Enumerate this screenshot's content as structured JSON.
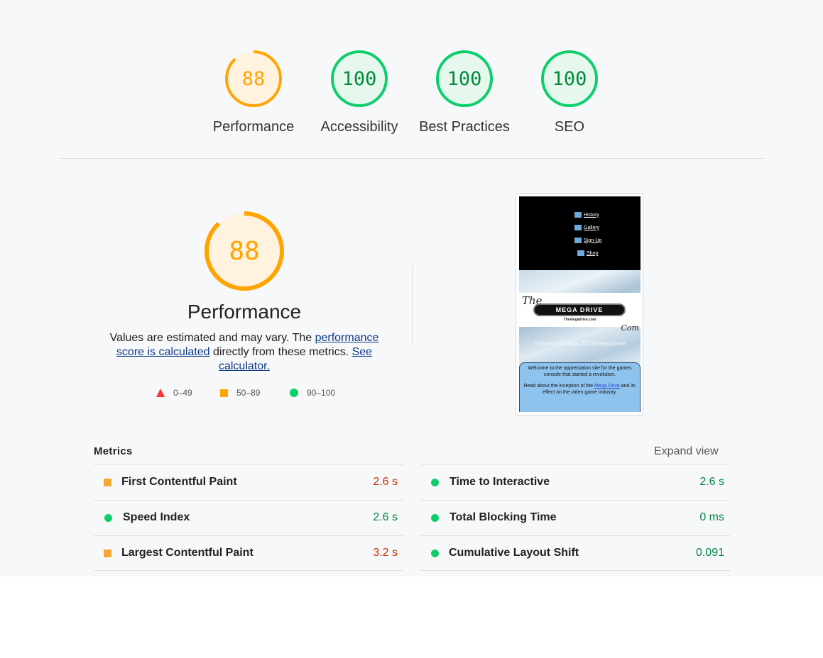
{
  "categories": [
    {
      "label": "Performance",
      "score": "88",
      "rating": "average"
    },
    {
      "label": "Accessibility",
      "score": "100",
      "rating": "pass"
    },
    {
      "label": "Best Practices",
      "score": "100",
      "rating": "pass"
    },
    {
      "label": "SEO",
      "score": "100",
      "rating": "pass"
    }
  ],
  "performance": {
    "score": "88",
    "title": "Performance",
    "desc_part1": "Values are estimated and may vary. The ",
    "desc_link1": "performance score is calculated",
    "desc_part2": " directly from these metrics. ",
    "desc_link2": "See calculator."
  },
  "legend": [
    {
      "range": "0–49",
      "shape": "triangle",
      "color": "#ff3333"
    },
    {
      "range": "50–89",
      "shape": "square",
      "color": "#ffa400"
    },
    {
      "range": "90–100",
      "shape": "circle",
      "color": "#0cce6b"
    }
  ],
  "thumbnail": {
    "nav": [
      "History",
      "Gallery",
      "Sign-Up",
      "Shop"
    ],
    "logo_the": "The",
    "logo_main": "MEGA DRIVE",
    "logo_site": "Themegadrive.com",
    "logo_com": "Com",
    "tagline": "Home of all things SEGA Megadrive",
    "welcome": "Welcome to the appreciation site for the games console that started a revolution.",
    "read_part1": "Read about the inception of the ",
    "read_link": "Mega Drive",
    "read_part2": " and its effect on the video game industry."
  },
  "metrics": {
    "title": "Metrics",
    "expand": "Expand view",
    "left": [
      {
        "name": "First Contentful Paint",
        "value": "2.6 s",
        "rating": "average"
      },
      {
        "name": "Speed Index",
        "value": "2.6 s",
        "rating": "pass"
      },
      {
        "name": "Largest Contentful Paint",
        "value": "3.2 s",
        "rating": "average"
      }
    ],
    "right": [
      {
        "name": "Time to Interactive",
        "value": "2.6 s",
        "rating": "pass"
      },
      {
        "name": "Total Blocking Time",
        "value": "0 ms",
        "rating": "pass"
      },
      {
        "name": "Cumulative Layout Shift",
        "value": "0.091",
        "rating": "pass"
      }
    ]
  },
  "colors": {
    "average": "#ffa400",
    "average_bg": "#fff3e0",
    "pass": "#0cce6b",
    "pass_bg": "#e6f8ee",
    "average_text": "#c33300",
    "pass_text": "#018642"
  }
}
